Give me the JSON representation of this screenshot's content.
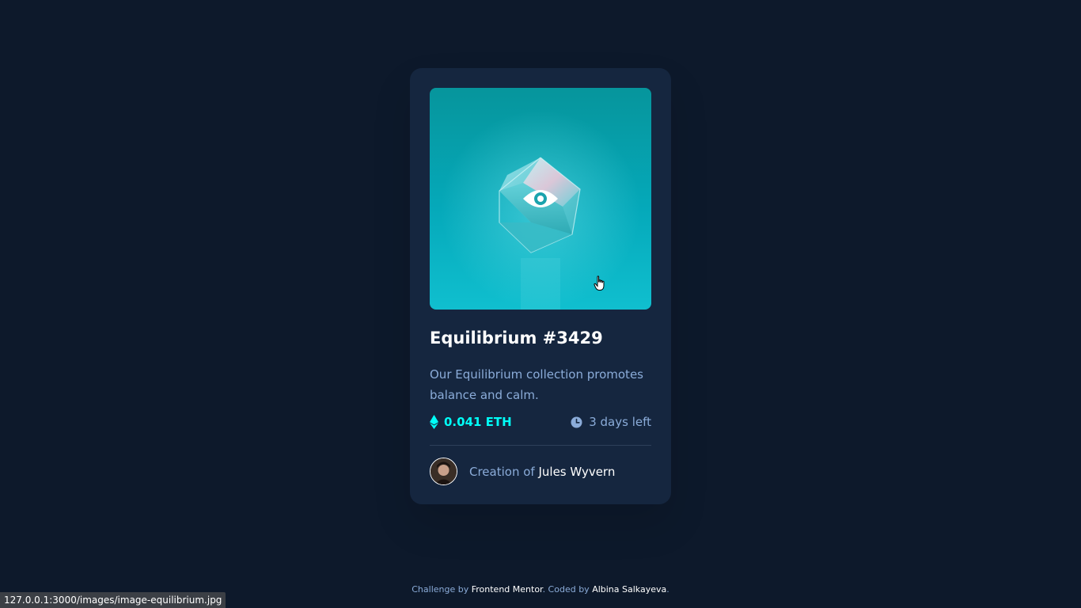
{
  "card": {
    "title": "Equilibrium #3429",
    "description": "Our Equilibrium collection promotes balance and calm.",
    "price": "0.041 ETH",
    "time_left": "3 days left",
    "creator_prefix": "Creation of ",
    "creator_name": "Jules Wyvern",
    "image_icon": "eye-icon",
    "price_icon": "ethereum-icon",
    "time_icon": "clock-icon"
  },
  "footer": {
    "challenge_prefix": "Challenge by ",
    "challenge_link": "Frontend Mentor",
    "coded_prefix": ". Coded by ",
    "coded_link": "Albina Salkayeva",
    "suffix": "."
  },
  "status_bar": {
    "url": "127.0.0.1:3000/images/image-equilibrium.jpg"
  },
  "colors": {
    "background": "#0d192b",
    "card": "#15263f",
    "accent": "#00fff8",
    "muted_text": "#8bacd9",
    "divider": "#2e405a"
  }
}
